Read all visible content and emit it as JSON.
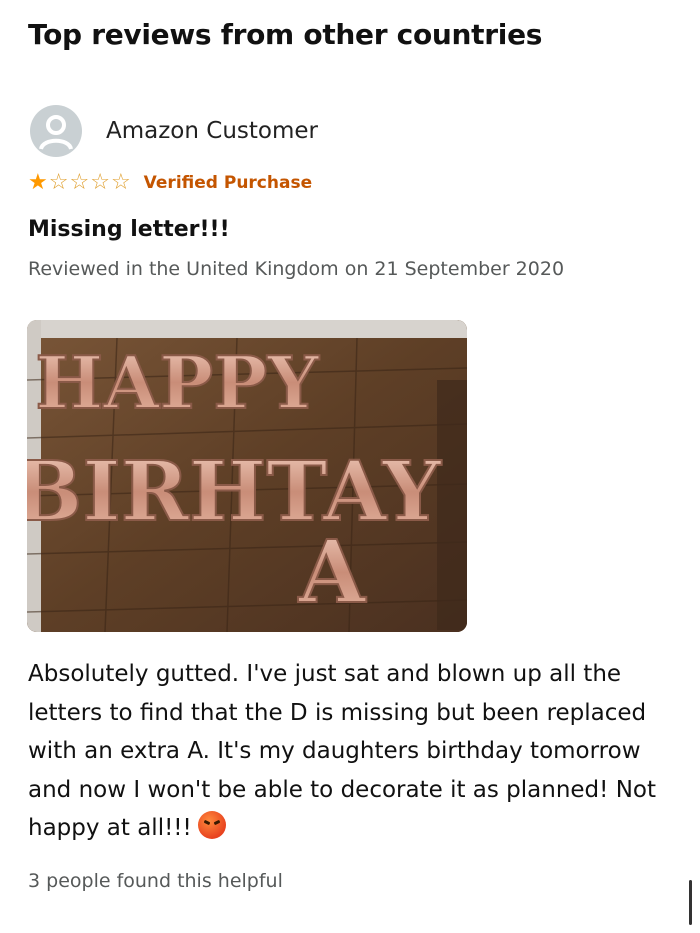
{
  "section": {
    "title": "Top reviews from other countries"
  },
  "review": {
    "author": "Amazon Customer",
    "rating": 1,
    "rating_max": 5,
    "verified": "Verified Purchase",
    "title": "Missing letter!!!",
    "meta": "Reviewed in the United Kingdom on 21 September 2020",
    "body": "Absolutely gutted. I've just sat and blown up all the letters to find that the D is missing but been replaced with an extra A. It's my daughters birthday tomorrow and now I won't be able to decorate it as planned! Not happy at all!!!",
    "body_emoji": "angry-face-icon",
    "helpful": "3 people found this helpful"
  },
  "photo": {
    "balloon_line1": "HAPPY",
    "balloon_line2": "BIRHTAY",
    "balloon_line3": "A"
  },
  "colors": {
    "star": "#ff9900",
    "verified": "#c45500",
    "meta": "#565959",
    "balloon": "#d9a48f"
  }
}
